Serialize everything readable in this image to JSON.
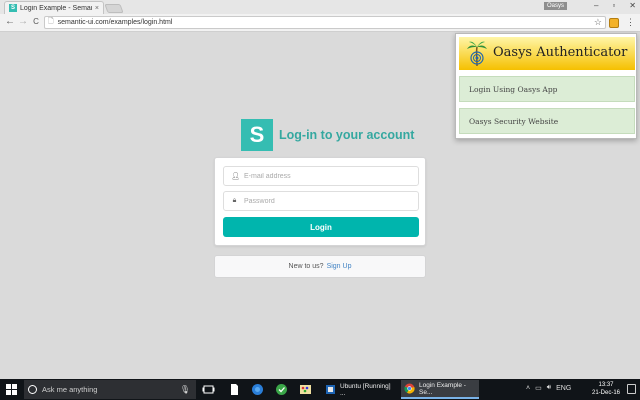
{
  "browser": {
    "tab_title": "Login Example - Seman",
    "tab_favicon": "S",
    "tab_close": "×",
    "user_chip": "Oasys",
    "window_controls": [
      "–",
      "▫",
      "✕"
    ],
    "url": "semantic-ui.com/examples/login.html",
    "back": "←",
    "forward": "→",
    "reload": "C",
    "star": "☆",
    "menu": "⋮"
  },
  "page": {
    "logo_letter": "S",
    "title": "Log-in to your account",
    "email_placeholder": "E-mail address",
    "password_placeholder": "Password",
    "login_button": "Login",
    "signup_text": "New to us?",
    "signup_link": "Sign Up",
    "accent_color": "#00b5ad"
  },
  "popup": {
    "title": "Oasys Authenticator",
    "items": [
      {
        "label": "Login Using Oasys App"
      },
      {
        "label": "Oasys Security Website"
      }
    ]
  },
  "taskbar": {
    "search_placeholder": "Ask me anything",
    "tasks": [
      {
        "label": "Ubuntu [Running] ..."
      },
      {
        "label": "Login Example - Se..."
      }
    ],
    "language": "ENG",
    "time": "13:37",
    "date": "21-Dec-16"
  }
}
